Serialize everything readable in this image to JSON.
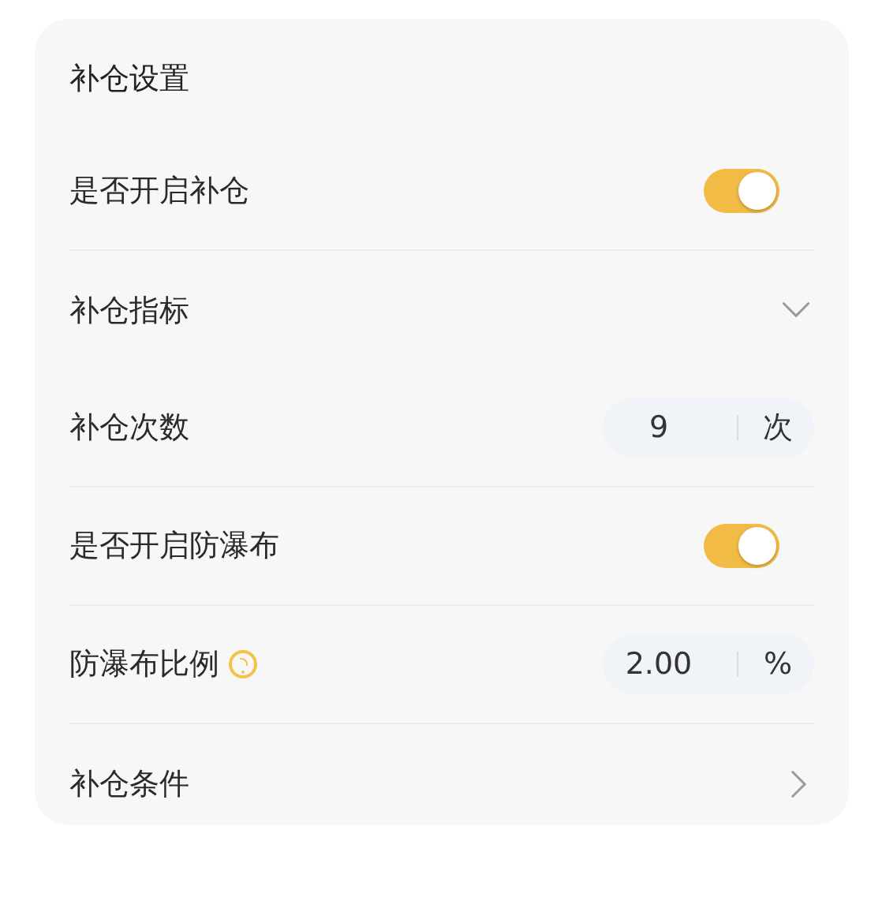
{
  "card": {
    "title": "补仓设置",
    "rows": [
      {
        "kind": "toggle",
        "label": "是否开启补仓",
        "on": true
      },
      {
        "kind": "dropdown",
        "label": "补仓指标",
        "expanded": true,
        "children": [
          {
            "kind": "number",
            "label": "补仓次数",
            "value": "9",
            "unit": "次"
          }
        ]
      },
      {
        "kind": "toggle",
        "label": "是否开启防瀑布",
        "on": true
      },
      {
        "kind": "number",
        "label": "防瀑布比例",
        "help": true,
        "value": "2.00",
        "unit": "%"
      },
      {
        "kind": "link",
        "label": "补仓条件"
      }
    ]
  }
}
